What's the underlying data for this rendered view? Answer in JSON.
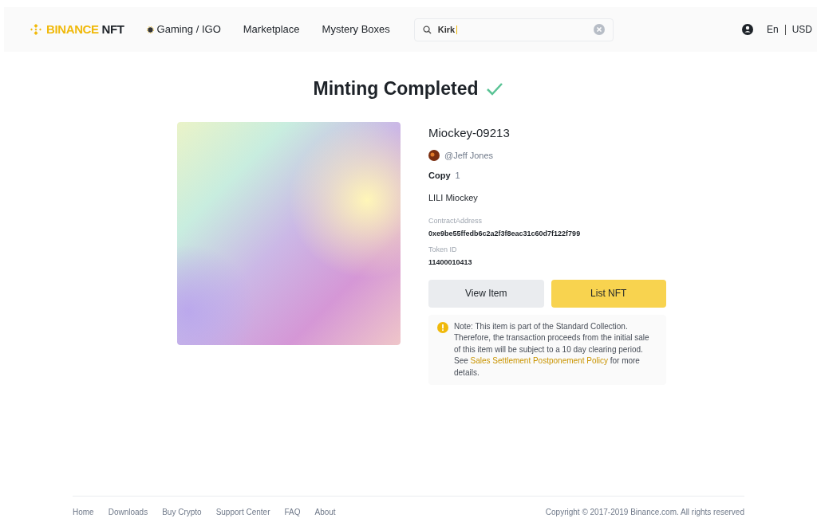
{
  "header": {
    "logo": {
      "brand": "BINANCE",
      "suffix": "NFT"
    },
    "nav": [
      {
        "label": "Gaming / IGO",
        "kind": "icon"
      },
      {
        "label": "Marketplace",
        "kind": "plain"
      },
      {
        "label": "Mystery Boxes",
        "kind": "plain"
      }
    ],
    "search": {
      "value": "Kirk"
    },
    "language": "En",
    "currency": "USD"
  },
  "title": "Minting Completed",
  "item": {
    "kind": "picture",
    "name": "Miockey-09213",
    "creator": "@Jeff Jones",
    "copy_label": "Copy",
    "copy_value": "1",
    "collection": "LILI Miockey",
    "contract_label": "ContractAddress",
    "contract_value": "0xe9be55ffedb6c2a2f3f8eac31c60d7f122f799",
    "token_label": "Token ID",
    "token_value": "11400010413"
  },
  "buttons": [
    {
      "label": "View Item",
      "kind": "secondary"
    },
    {
      "label": "List NFT",
      "kind": "primary"
    }
  ],
  "note": {
    "before": "Note: This item is part of the Standard Collection. Therefore, the transaction proceeds from the initial sale of this item will be subject to a 10 day clearing period. See ",
    "link": "Sales Settlement Postponement Policy",
    "after": " for more details."
  },
  "footer": {
    "links": [
      "Home",
      "Downloads",
      "Buy Crypto",
      "Support Center",
      "FAQ",
      "About"
    ],
    "copyright": "Copyright © 2017-2019 Binance.com. All rights reserved"
  }
}
